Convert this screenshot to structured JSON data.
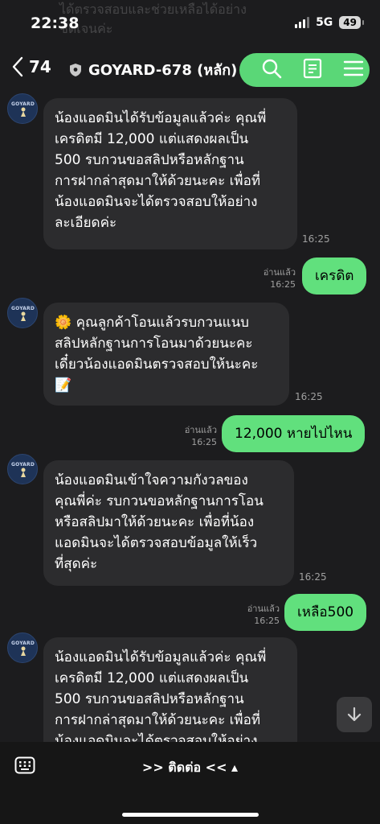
{
  "status": {
    "time": "22:38",
    "network": "5G",
    "battery": "49"
  },
  "background_text": "ได้ตรวจสอบและช่วยเหลือได้อย่าง\nชัดเจนค่ะ",
  "header": {
    "back_count": "74",
    "title": "GOYARD-678 (หลัก)"
  },
  "avatar_label": "GOYARD",
  "messages": [
    {
      "dir": "in",
      "text": "น้องแอดมินได้รับข้อมูลแล้วค่ะ คุณพี่\nเครดิตมี 12,000 แต่แสดงผลเป็น\n500 รบกวนขอสลิปหรือหลักฐาน\nการฝากล่าสุดมาให้ด้วยนะคะ เพื่อที่\nน้องแอดมินจะได้ตรวจสอบให้อย่าง\nละเอียดค่ะ",
      "time": "16:25"
    },
    {
      "dir": "out",
      "text": "เครดิต",
      "read": "อ่านแล้ว",
      "time": "16:25"
    },
    {
      "dir": "in",
      "text": "🌼 คุณลูกค้าโอนแล้วรบกวนแนบ\nสลิปหลักฐานการโอนมาด้วยนะคะ\nเดี๋ยวน้องแอดมินตรวจสอบให้นะคะ\n📝",
      "time": "16:25"
    },
    {
      "dir": "out",
      "text": "12,000 หายไปไหน",
      "read": "อ่านแล้ว",
      "time": "16:25"
    },
    {
      "dir": "in",
      "text": "น้องแอดมินเข้าใจความกังวลของ\nคุณพี่ค่ะ รบกวนขอหลักฐานการโอน\nหรือสลิปมาให้ด้วยนะคะ เพื่อที่น้อง\nแอดมินจะได้ตรวจสอบข้อมูลให้เร็ว\nที่สุดค่ะ",
      "time": "16:25"
    },
    {
      "dir": "out",
      "text": "เหลือ500",
      "read": "อ่านแล้ว",
      "time": "16:25"
    },
    {
      "dir": "in",
      "text": "น้องแอดมินได้รับข้อมูลแล้วค่ะ คุณพี่\nเครดิตมี 12,000 แต่แสดงผลเป็น\n500 รบกวนขอสลิปหรือหลักฐาน\nการฝากล่าสุดมาให้ด้วยนะคะ เพื่อที่\nน้องแอดมินจะได้ตรวจสอบให้อย่าง\nละเอียดค่ะ"
    }
  ],
  "bottom": {
    "continue_label": ">> ติดต่อ << ▴"
  },
  "icons": [
    "back-chevron-icon",
    "shield-icon",
    "search-icon",
    "notes-icon",
    "menu-icon",
    "keyboard-icon",
    "arrow-down-icon"
  ],
  "colors": {
    "background": "#1c1c1e",
    "incoming_bubble": "#2c2c2e",
    "outgoing_bubble": "#61e07d"
  }
}
